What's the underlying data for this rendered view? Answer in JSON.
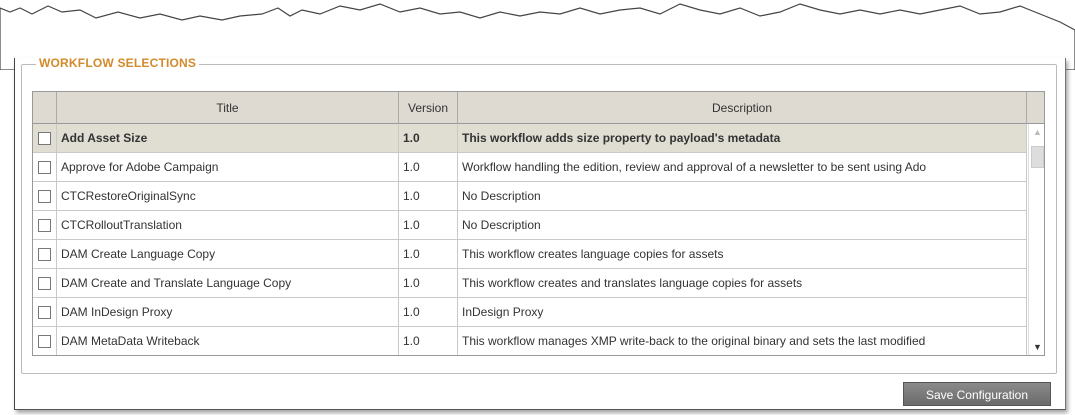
{
  "panel": {
    "legend": "WORKFLOW SELECTIONS",
    "save_label": "Save Configuration"
  },
  "table": {
    "headers": {
      "title": "Title",
      "version": "Version",
      "description": "Description"
    },
    "rows": [
      {
        "title": "Add Asset Size",
        "version": "1.0",
        "description": "This workflow adds size property to payload's metadata",
        "selected": true,
        "checked": false
      },
      {
        "title": "Approve for Adobe Campaign",
        "version": "1.0",
        "description": "Workflow handling the edition, review and approval of a newsletter to be sent using Ado",
        "selected": false,
        "checked": false
      },
      {
        "title": "CTCRestoreOriginalSync",
        "version": "1.0",
        "description": "No Description",
        "selected": false,
        "checked": false
      },
      {
        "title": "CTCRolloutTranslation",
        "version": "1.0",
        "description": "No Description",
        "selected": false,
        "checked": false
      },
      {
        "title": "DAM Create Language Copy",
        "version": "1.0",
        "description": "This workflow creates language copies for assets",
        "selected": false,
        "checked": false
      },
      {
        "title": "DAM Create and Translate Language Copy",
        "version": "1.0",
        "description": "This workflow creates and translates language copies for assets",
        "selected": false,
        "checked": false
      },
      {
        "title": "DAM InDesign Proxy",
        "version": "1.0",
        "description": "InDesign Proxy",
        "selected": false,
        "checked": false
      },
      {
        "title": "DAM MetaData Writeback",
        "version": "1.0",
        "description": "This workflow manages XMP write-back to the original binary and sets the last modified",
        "selected": false,
        "checked": false
      }
    ]
  },
  "icons": {
    "scroll_up": "chevron-up-icon",
    "scroll_down": "chevron-down-icon"
  },
  "colors": {
    "legend": "#d38a2a",
    "button_bg": "#7a7a7a",
    "selected_row": "#e0ddd3",
    "header_bg": "#dedad2"
  }
}
